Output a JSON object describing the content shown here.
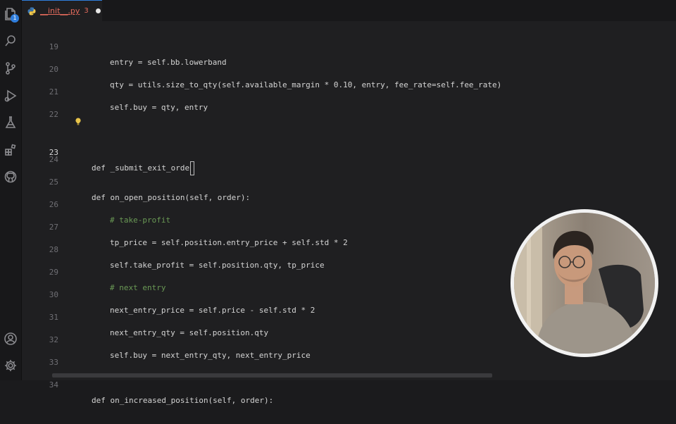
{
  "activity_bar": {
    "explorer_badge": "1",
    "icons": [
      "files-icon",
      "search-icon",
      "source-control-icon",
      "run-debug-icon",
      "testing-icon",
      "extensions-icon",
      "github-icon",
      "account-icon",
      "gear-icon"
    ]
  },
  "tab": {
    "label": "__init__.py",
    "problems": "3",
    "modified": true
  },
  "editor": {
    "lines": [
      {
        "n": "19",
        "text": "entry = self.bb.lowerband"
      },
      {
        "n": "20",
        "text": "qty = utils.size_to_qty(self.available_margin * 0.10, entry, fee_rate=self.fee_rate)"
      },
      {
        "n": "21",
        "text": "self.buy = qty, entry"
      },
      {
        "n": "22",
        "text": ""
      },
      {
        "n": "23",
        "text": "def _submit_exit_orde"
      },
      {
        "n": "24",
        "text": ""
      },
      {
        "n": "25",
        "text": "def on_open_position(self, order):"
      },
      {
        "n": "26",
        "text": "# take-profit"
      },
      {
        "n": "27",
        "text": "tp_price = self.position.entry_price + self.std * 2"
      },
      {
        "n": "28",
        "text": "self.take_profit = self.position.qty, tp_price"
      },
      {
        "n": "29",
        "text": "# next entry"
      },
      {
        "n": "30",
        "text": "next_entry_price = self.price - self.std * 2"
      },
      {
        "n": "31",
        "text": "next_entry_qty = self.position.qty"
      },
      {
        "n": "32",
        "text": "self.buy = next_entry_qty, next_entry_price"
      },
      {
        "n": "33",
        "text": ""
      },
      {
        "n": "34",
        "text": "def on_increased_position(self, order):"
      }
    ]
  },
  "colors": {
    "accent": "#2f7ddc",
    "keyword": "#569cd6",
    "function": "#dcdcaa",
    "comment": "#6a9955",
    "number": "#b5cea8",
    "error": "#e46b5c"
  }
}
